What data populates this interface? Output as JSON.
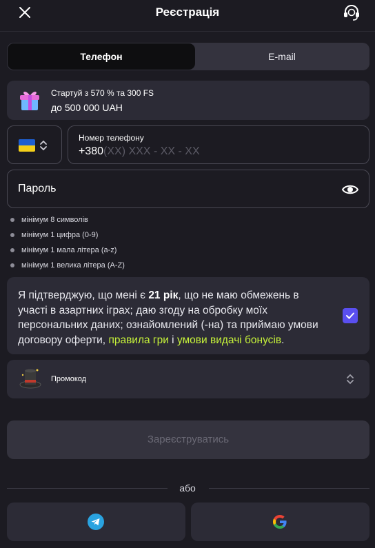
{
  "header": {
    "title": "Реєстрація",
    "close_icon": "close-icon",
    "support_icon": "support-headset-icon"
  },
  "tabs": [
    {
      "label": "Телефон",
      "active": true
    },
    {
      "label": "E-mail",
      "active": false
    }
  ],
  "bonus": {
    "line1": "Стартуй з 570 % та 300 FS",
    "line2": "до 500 000 UAH",
    "icon": "gift-icon"
  },
  "phone": {
    "country_flag": "ukraine-flag",
    "label": "Номер телефону",
    "prefix": "+380",
    "mask": "(XX) XXX - XX - XX"
  },
  "password": {
    "placeholder": "Пароль",
    "icon": "eye-icon"
  },
  "password_rules": [
    "мінімум 8 символів",
    "мінімум 1 цифра (0-9)",
    "мінімум 1 мала літера (a-z)",
    "мінімум 1 велика літера (A-Z)"
  ],
  "consent": {
    "part1": "Я підтверджую, що мені є ",
    "age": "21 рік",
    "part2": ", що не маю обмежень в участі в азартних іграх; даю згоду на обробку моїх персональних даних; ознайомлений (-на) та приймаю умови договору оферти, ",
    "link1": "правила гри",
    "and": " і ",
    "link2": "умови видачі бонусів",
    "end": ".",
    "checked": true
  },
  "promo": {
    "label": "Промокод",
    "icon": "magic-hat-icon"
  },
  "register_button": "Зареєструватись",
  "divider_text": "або",
  "social": [
    {
      "name": "telegram",
      "icon": "telegram-icon"
    },
    {
      "name": "google",
      "icon": "google-icon"
    }
  ],
  "colors": {
    "background": "#1c1b22",
    "card": "#2c2b36",
    "accent_green": "#c6f23a",
    "checkbox": "#5a4ff0"
  }
}
